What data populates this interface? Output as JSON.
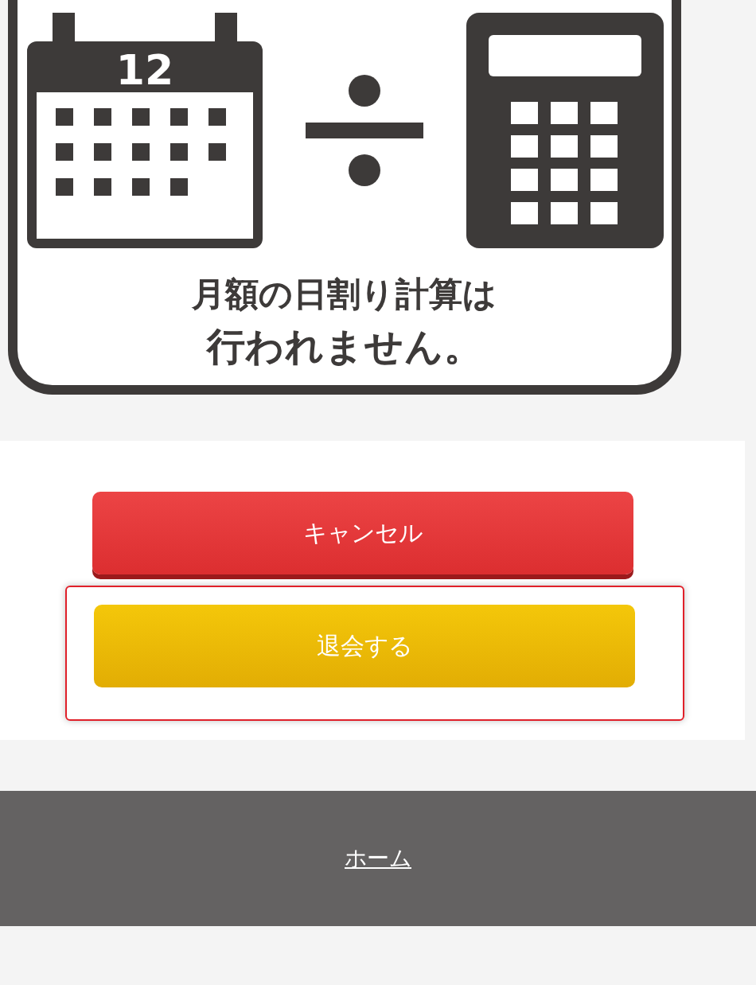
{
  "notice_card": {
    "calendar_day": "12",
    "lines": [
      "月額の日割り計算は",
      "行われません。"
    ]
  },
  "buttons": [
    {
      "label": "キャンセル",
      "kind": "cancel",
      "highlighted": false
    },
    {
      "label": "退会する",
      "kind": "confirm",
      "highlighted": true
    }
  ],
  "footer": {
    "link": "ホーム"
  }
}
